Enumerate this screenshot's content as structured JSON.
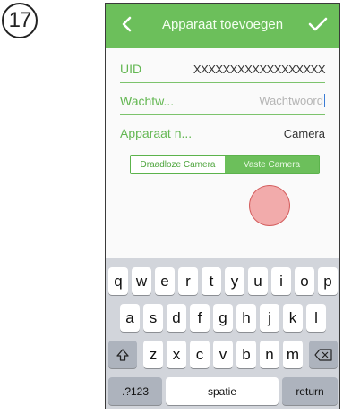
{
  "step_number": "17",
  "navbar": {
    "title": "Apparaat toevoegen",
    "accent": "#6cbf5b"
  },
  "form": {
    "uid": {
      "label": "UID",
      "value": "XXXXXXXXXXXXXXXXXX"
    },
    "password": {
      "label": "Wachtw...",
      "placeholder": "Wachtwoord"
    },
    "device_name": {
      "label": "Apparaat n...",
      "value": "Camera"
    }
  },
  "segment": {
    "options": [
      "Draadloze Camera",
      "Vaste Camera"
    ],
    "selected_index": 1
  },
  "keyboard": {
    "row1": [
      "q",
      "w",
      "e",
      "r",
      "t",
      "y",
      "u",
      "i",
      "o",
      "p"
    ],
    "row2": [
      "a",
      "s",
      "d",
      "f",
      "g",
      "h",
      "j",
      "k",
      "l"
    ],
    "row3": [
      "z",
      "x",
      "c",
      "v",
      "b",
      "n",
      "m"
    ],
    "numbers_label": ".?123",
    "space_label": "spatie",
    "return_label": "return",
    "shift_icon": "shift-icon",
    "backspace_icon": "backspace-icon"
  }
}
